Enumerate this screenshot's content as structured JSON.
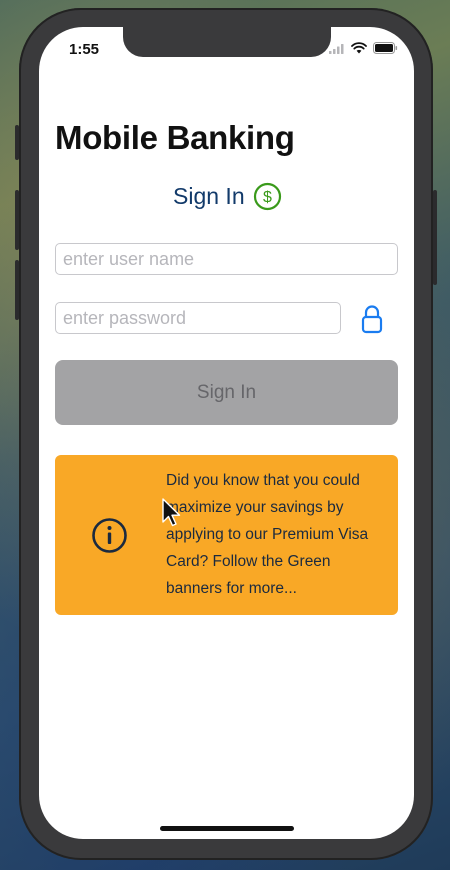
{
  "status_bar": {
    "time": "1:55"
  },
  "app": {
    "title": "Mobile Banking",
    "signin_heading": "Sign In",
    "signin_icon": "dollar-circle-icon",
    "icon_color": "#3a9a1b"
  },
  "form": {
    "username_placeholder": "enter user name",
    "username_value": "",
    "password_placeholder": "enter password",
    "password_value": "",
    "lock_icon": "lock-icon",
    "lock_color": "#1a7cf0",
    "submit_label": "Sign In"
  },
  "promo": {
    "icon": "info-icon",
    "background": "#f9a826",
    "text": "Did you know that you could maximize your savings by applying to our Premium Visa Card? Follow the Green banners for more..."
  }
}
